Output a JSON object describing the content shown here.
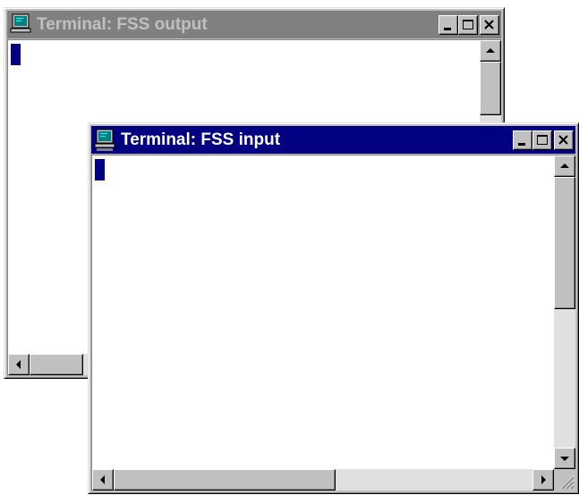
{
  "windows": {
    "output": {
      "title": "Terminal: FSS output",
      "state": "inactive"
    },
    "input": {
      "title": "Terminal: FSS input",
      "state": "active"
    }
  },
  "colors": {
    "active_titlebar": "#000080",
    "inactive_titlebar": "#808080",
    "cursor": "#000080"
  },
  "icons": {
    "app": "terminal-monitor-icon",
    "minimize": "minimize-icon",
    "maximize": "maximize-icon",
    "close": "close-icon",
    "scroll_up": "arrow-up-icon",
    "scroll_down": "arrow-down-icon",
    "scroll_left": "arrow-left-icon",
    "scroll_right": "arrow-right-icon",
    "resize": "resize-grip-icon"
  }
}
